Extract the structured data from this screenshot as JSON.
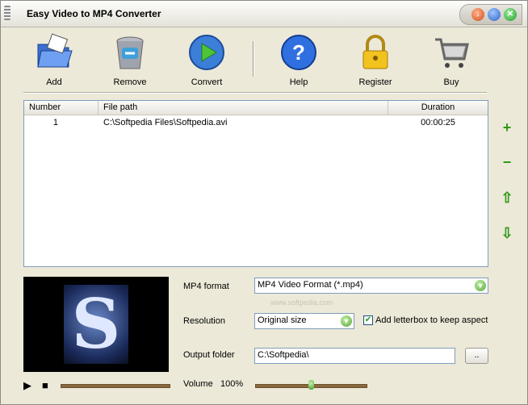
{
  "window": {
    "title": "Easy Video to MP4 Converter",
    "controls": {
      "minimize": "↓",
      "maximize": "",
      "close": "✕"
    }
  },
  "toolbar": {
    "add": "Add",
    "remove": "Remove",
    "convert": "Convert",
    "help": "Help",
    "register": "Register",
    "buy": "Buy"
  },
  "file_list": {
    "columns": [
      "Number",
      "File path",
      "Duration"
    ],
    "rows": [
      {
        "number": "1",
        "path": "C:\\Softpedia Files\\Softpedia.avi",
        "duration": "00:00:25"
      }
    ]
  },
  "side_buttons": {
    "add": "+",
    "remove": "−",
    "up": "⇧",
    "down": "⇩"
  },
  "preview": {
    "glyph": "S"
  },
  "settings": {
    "format_label": "MP4 format",
    "format_value": "MP4 Video Format (*.mp4)",
    "resolution_label": "Resolution",
    "resolution_value": "Original size",
    "letterbox_label": "Add letterbox to keep aspect",
    "letterbox_checked": true,
    "letterbox_mark": "✔",
    "output_label": "Output folder",
    "output_value": "C:\\Softpedia\\",
    "browse_label": "..",
    "volume_label": "Volume",
    "volume_value": "100%",
    "volume_level": 0.5
  },
  "playback": {
    "play": "▶",
    "stop": "■",
    "position": 0
  },
  "watermark": "www.softpedia.com",
  "colors": {
    "accent_green": "#2e9a16",
    "list_border": "#7f9db9",
    "bg": "#ece9d8"
  }
}
